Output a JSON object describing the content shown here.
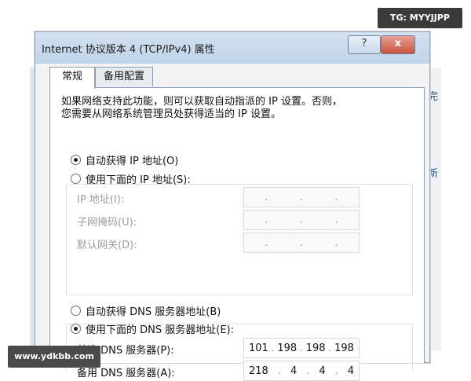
{
  "window": {
    "title": "Internet 协议版本 4 (TCP/IPv4) 属性",
    "help_label": "?",
    "close_label": "x"
  },
  "tabs": [
    {
      "label": "常规",
      "active": true
    },
    {
      "label": "备用配置",
      "active": false
    }
  ],
  "description": {
    "line1": "如果网络支持此功能，则可以获取自动指派的 IP 设置。否则，",
    "line2": "您需要从网络系统管理员处获得适当的 IP 设置。"
  },
  "ip_section": {
    "auto_label": "自动获得 IP 地址(O)",
    "manual_label": "使用下面的 IP 地址(S):",
    "selected": "auto",
    "fields": [
      {
        "label": "IP 地址(I):",
        "value": [
          "",
          "",
          "",
          ""
        ]
      },
      {
        "label": "子网掩码(U):",
        "value": [
          "",
          "",
          "",
          ""
        ]
      },
      {
        "label": "默认网关(D):",
        "value": [
          "",
          "",
          "",
          ""
        ]
      }
    ]
  },
  "dns_section": {
    "auto_label": "自动获得 DNS 服务器地址(B)",
    "manual_label": "使用下面的 DNS 服务器地址(E):",
    "selected": "manual",
    "fields": [
      {
        "label": "首选 DNS 服务器(P):",
        "value": [
          "101",
          "198",
          "198",
          "198"
        ]
      },
      {
        "label": "备用 DNS 服务器(A):",
        "value": [
          "218",
          "4",
          "4",
          "4"
        ]
      }
    ]
  },
  "background": {
    "right_fragments": [
      "完",
      "新"
    ]
  },
  "watermarks": {
    "top_right": "TG: MYYJJPP",
    "bottom_left": "www.ydkbb.com"
  }
}
